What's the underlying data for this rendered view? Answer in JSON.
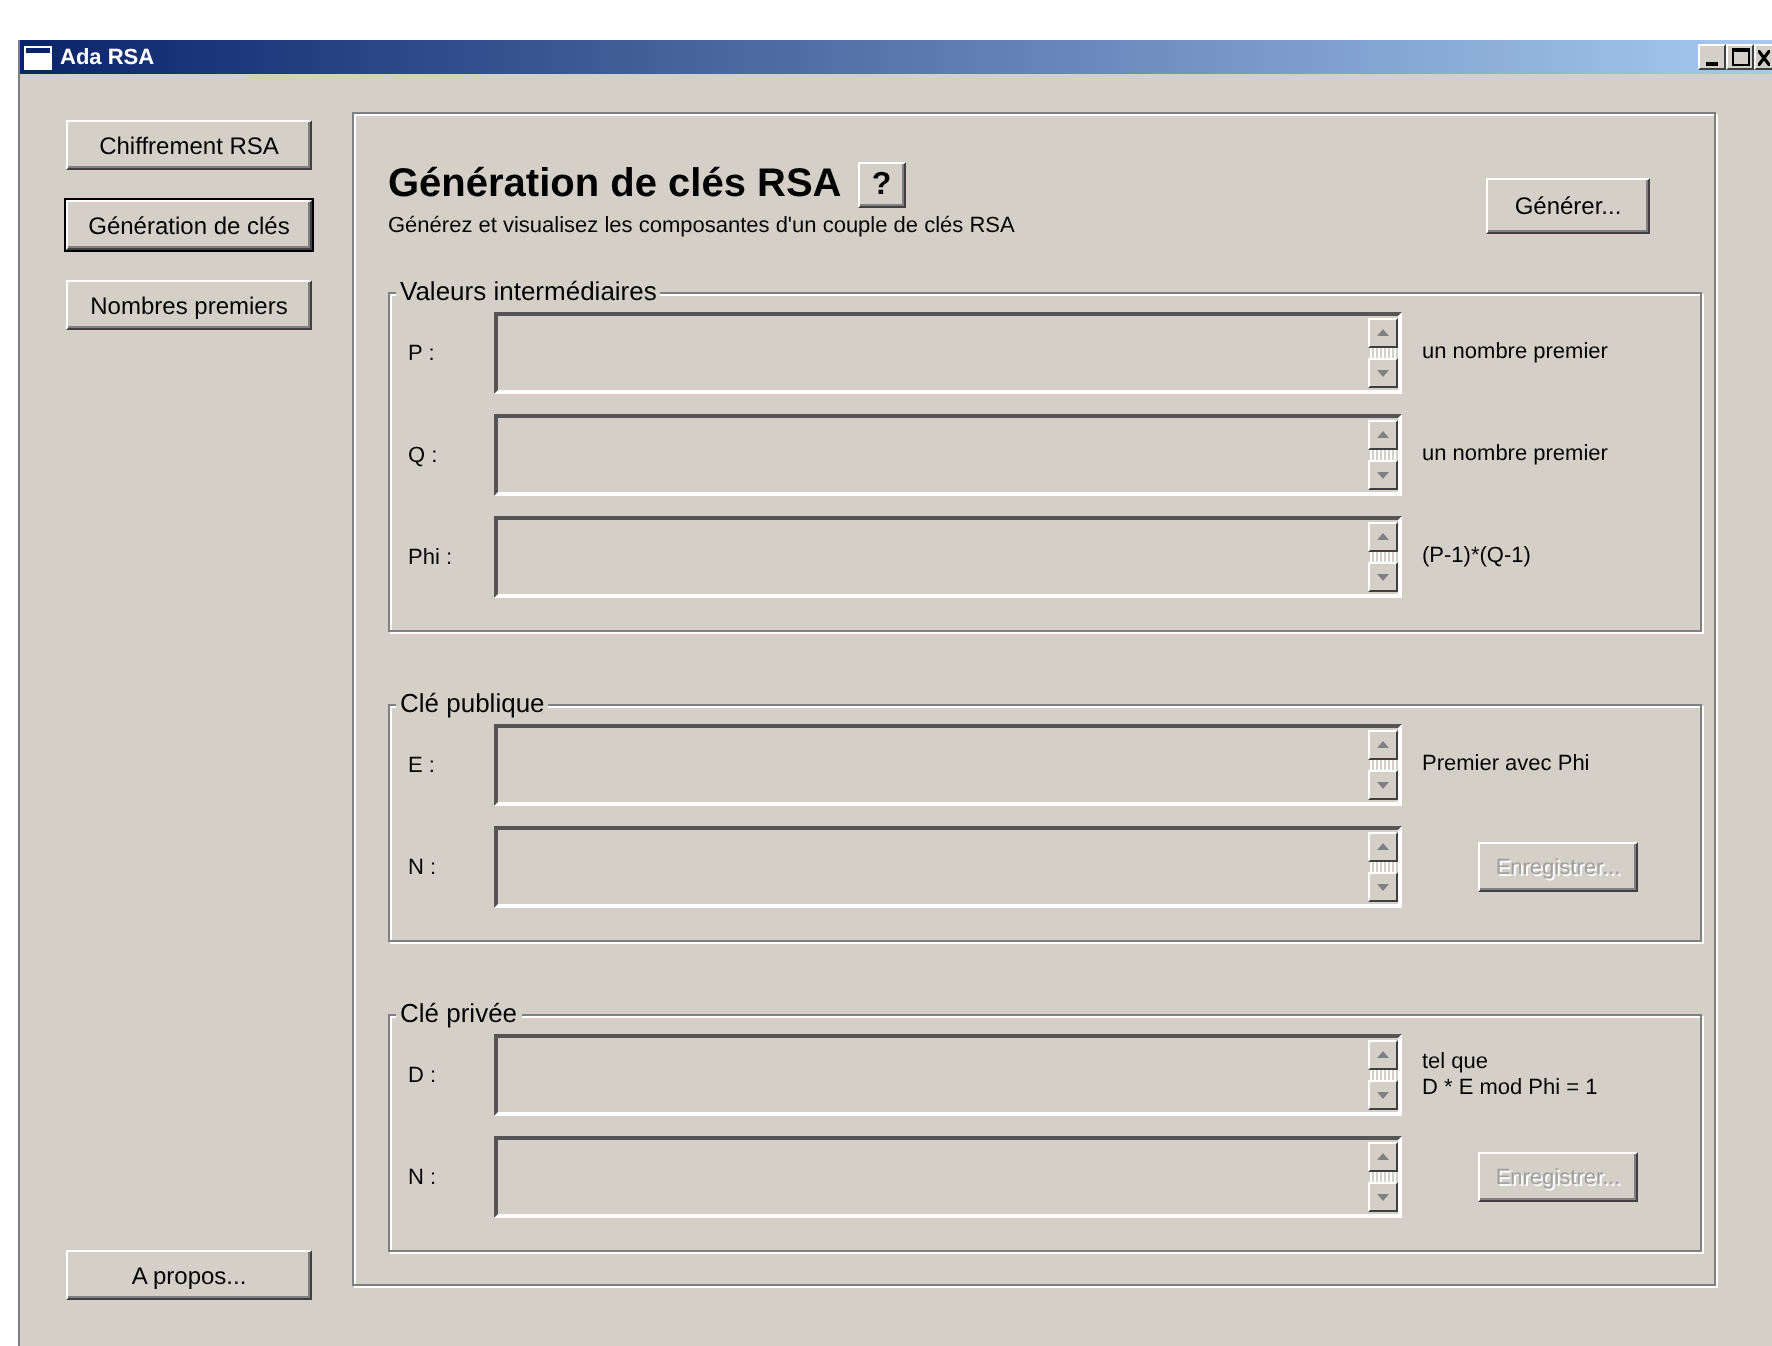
{
  "window": {
    "title": "Ada RSA"
  },
  "sidebar": {
    "items": [
      {
        "label": "Chiffrement RSA",
        "selected": false
      },
      {
        "label": "Génération de clés",
        "selected": true
      },
      {
        "label": "Nombres premiers",
        "selected": false
      }
    ],
    "about_button": "A propos..."
  },
  "panel": {
    "title": "Génération de clés RSA",
    "help_button": "?",
    "subtitle": "Générez et visualisez les composantes d'un couple de clés RSA",
    "generate_button": "Générer...",
    "groups": [
      {
        "title": "Valeurs intermédiaires",
        "rows": [
          {
            "label": "P :",
            "kind": "note",
            "note": "un nombre premier"
          },
          {
            "label": "Q :",
            "kind": "note",
            "note": "un nombre premier"
          },
          {
            "label": "Phi :",
            "kind": "note",
            "note": "(P-1)*(Q-1)"
          }
        ]
      },
      {
        "title": "Clé publique",
        "rows": [
          {
            "label": "E :",
            "kind": "note",
            "note": "Premier avec Phi"
          },
          {
            "label": "N :",
            "kind": "button",
            "button": "Enregistrer...",
            "disabled": true
          }
        ]
      },
      {
        "title": "Clé privée",
        "rows": [
          {
            "label": "D :",
            "kind": "note",
            "note": "tel que\nD * E mod Phi = 1"
          },
          {
            "label": "N :",
            "kind": "button",
            "button": "Enregistrer...",
            "disabled": true
          }
        ]
      }
    ]
  }
}
